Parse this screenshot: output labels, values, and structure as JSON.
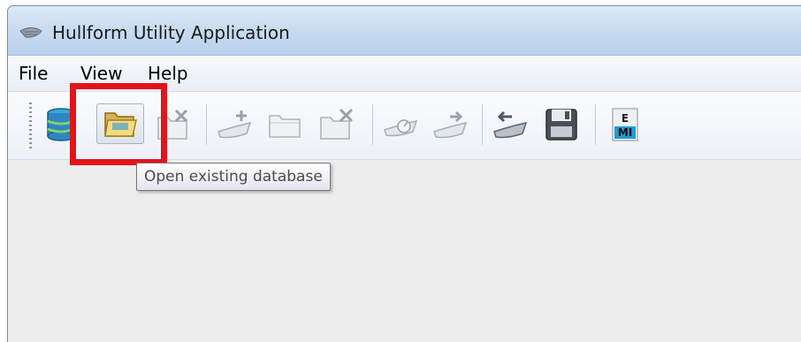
{
  "window": {
    "title": "Hullform Utility Application",
    "icon": "hull-icon"
  },
  "menu": {
    "items": [
      "File",
      "View",
      "Help"
    ]
  },
  "toolbar": {
    "buttons": [
      {
        "name": "database-icon",
        "state": "enabled"
      },
      {
        "name": "open-folder-icon",
        "state": "hover"
      },
      {
        "name": "close-database-icon",
        "state": "disabled"
      },
      {
        "name": "add-hull-icon",
        "state": "disabled"
      },
      {
        "name": "folder-icon",
        "state": "disabled"
      },
      {
        "name": "delete-folder-icon",
        "state": "disabled"
      },
      {
        "name": "hull-gauge-icon",
        "state": "disabled"
      },
      {
        "name": "export-hull-icon",
        "state": "disabled"
      },
      {
        "name": "import-hull-icon",
        "state": "enabled"
      },
      {
        "name": "save-icon",
        "state": "enabled"
      },
      {
        "name": "em-icon",
        "state": "enabled"
      }
    ],
    "em_label_top": "E",
    "em_label_bottom": "MI"
  },
  "tooltip": {
    "text": "Open existing database"
  },
  "colors": {
    "highlight": "#e4141b",
    "titlebar": "#c9dcf1"
  }
}
